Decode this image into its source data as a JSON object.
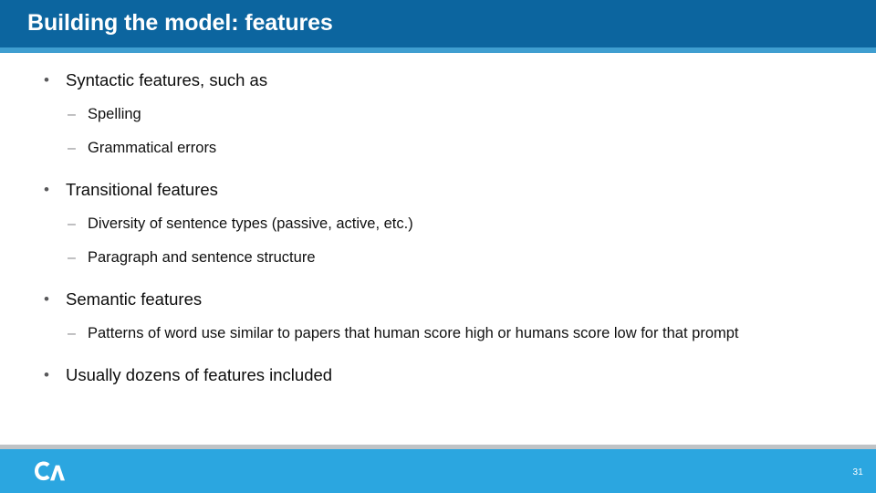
{
  "slide": {
    "title": "Building the model: features",
    "page_number": "31",
    "logo_alt": "CA",
    "colors": {
      "header_blue": "#0c659f",
      "accent_blue": "#3f9ed0",
      "footer_blue": "#2ba6e0",
      "divider_gray": "#bfc3c6",
      "body_text": "#0d0d0d",
      "marker_gray": "#8a8a8c"
    }
  },
  "markers": {
    "level1": "•",
    "level2": "–"
  },
  "bullets": [
    {
      "level": 1,
      "text": "Syntactic features, such as"
    },
    {
      "level": 2,
      "text": "Spelling"
    },
    {
      "level": 2,
      "text": "Grammatical errors"
    },
    {
      "level": 1,
      "text": "Transitional features"
    },
    {
      "level": 2,
      "text": "Diversity of sentence types (passive, active, etc.)"
    },
    {
      "level": 2,
      "text": "Paragraph and sentence structure"
    },
    {
      "level": 1,
      "text": "Semantic features"
    },
    {
      "level": 2,
      "text": "Patterns of word use similar to papers that human score high or humans score low for that prompt"
    },
    {
      "level": 1,
      "text": "Usually dozens of features included"
    }
  ]
}
